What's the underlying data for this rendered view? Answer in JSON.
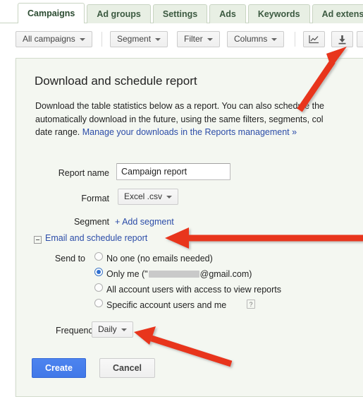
{
  "tabs": [
    {
      "label": "Campaigns",
      "active": true
    },
    {
      "label": "Ad groups",
      "active": false
    },
    {
      "label": "Settings",
      "active": false
    },
    {
      "label": "Ads",
      "active": false
    },
    {
      "label": "Keywords",
      "active": false
    },
    {
      "label": "Ad extensions",
      "active": false
    }
  ],
  "toolbar": {
    "campaign_scope": "All campaigns",
    "segment": "Segment",
    "filter": "Filter",
    "columns": "Columns",
    "chart_icon": "line-chart-icon",
    "download_icon": "download-icon"
  },
  "dialog": {
    "title": "Download and schedule report",
    "description_line1": "Download the table statistics below as a report. You can also schedule the",
    "description_line2": "automatically download in the future, using the same filters, segments, col",
    "description_line3_prefix": "date range. ",
    "description_link": "Manage your downloads in the Reports management »",
    "report_name_label": "Report name",
    "report_name_value": "Campaign report",
    "report_name_placeholder": "Report name",
    "format_label": "Format",
    "format_value": "Excel .csv",
    "segment_label": "Segment",
    "segment_link": "+ Add segment",
    "email_section_label": "Email and schedule report",
    "email_section_expanded": true,
    "send_to_label": "Send to",
    "send_to_options": [
      {
        "label": "No one (no emails needed)",
        "selected": false,
        "redacted": false
      },
      {
        "label_prefix": "Only me (\"",
        "label_suffix": "@gmail.com)",
        "selected": true,
        "redacted": true
      },
      {
        "label": "All account users with access to view reports",
        "selected": false,
        "redacted": false
      },
      {
        "label": "Specific account users and me",
        "selected": false,
        "redacted": false,
        "help": "?"
      }
    ],
    "frequency_label": "Frequency",
    "frequency_value": "Daily",
    "create_label": "Create",
    "cancel_label": "Cancel"
  },
  "annotations": {
    "arrow_color": "#e8341c",
    "arrow_count": 3
  }
}
